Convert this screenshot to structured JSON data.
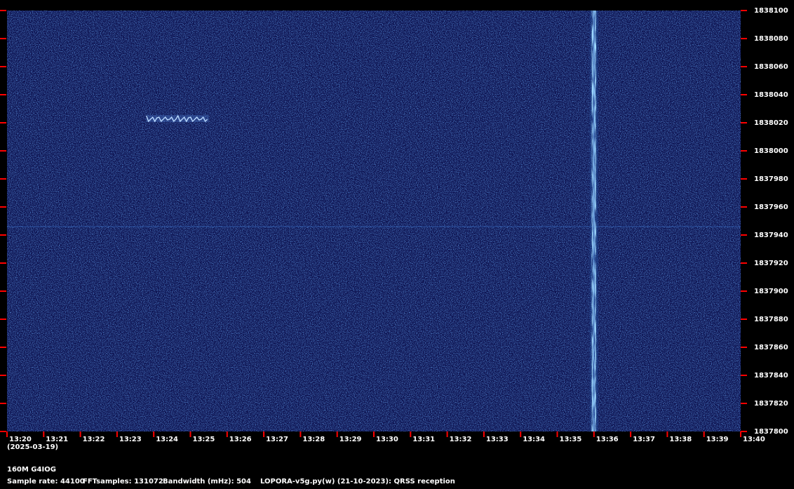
{
  "chart_data": {
    "type": "heatmap",
    "title": "",
    "xlabel": "",
    "ylabel": "",
    "colors": {
      "background": "#000000",
      "waterfall": "#0d1250",
      "tick": "#ff0000",
      "signal": "#b8d8ff",
      "text": "#ffffff"
    },
    "x_ticks": [
      "13:20",
      "13:21",
      "13:22",
      "13:23",
      "13:24",
      "13:25",
      "13:26",
      "13:27",
      "13:28",
      "13:29",
      "13:30",
      "13:31",
      "13:32",
      "13:33",
      "13:34",
      "13:35",
      "13:36",
      "13:37",
      "13:38",
      "13:39",
      "13:40"
    ],
    "y_ticks": [
      "1838100",
      "1838080",
      "1838060",
      "1838040",
      "1838020",
      "1838000",
      "1837980",
      "1837960",
      "1837940",
      "1837920",
      "1837900",
      "1837880",
      "1837860",
      "1837840",
      "1837820",
      "1837800"
    ],
    "ylim": [
      1837800,
      1838100
    ],
    "x_range": [
      "13:20",
      "13:40"
    ],
    "grid": false,
    "features": [
      {
        "kind": "qrss-signal",
        "t_start": "13:23.8",
        "t_end": "13:25.5",
        "freq": 1838023
      },
      {
        "kind": "carrier-line",
        "freq": 1837946
      },
      {
        "kind": "broadband-burst",
        "time": "13:36"
      }
    ]
  },
  "footer": {
    "date": "(2025-03-19)",
    "station": "160M G4IOG",
    "sample_rate": "Sample rate: 44100",
    "fft_samples": "FFTsamples: 131072",
    "bandwidth": "Bandwidth (mHz): 504",
    "software": "LOPORA-v5g.py(w) (21-10-2023): QRSS reception"
  }
}
